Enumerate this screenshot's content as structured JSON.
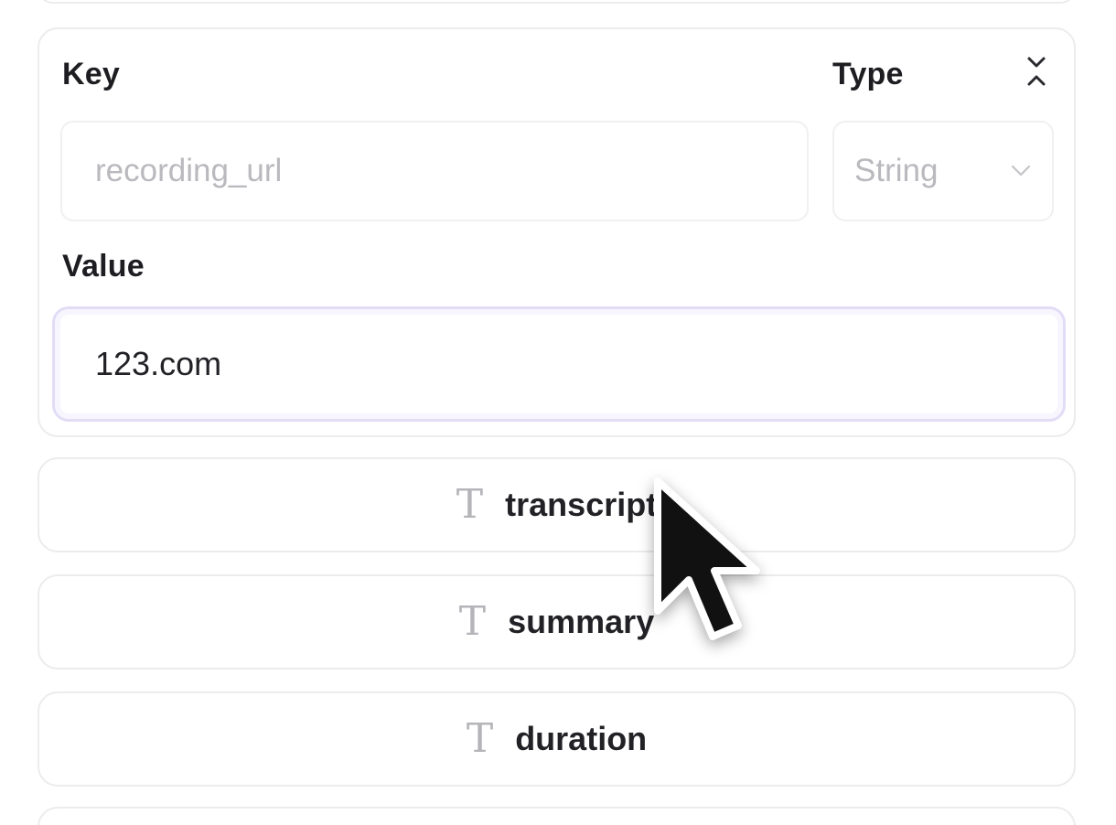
{
  "field_editor": {
    "key_label": "Key",
    "type_label": "Type",
    "value_label": "Value",
    "key_placeholder": "recording_url",
    "type_selected": "String",
    "value": "123.com",
    "collapse_icon": "collapse-chevrons-icon"
  },
  "fields": [
    {
      "icon": "text-type-icon",
      "label": "transcript"
    },
    {
      "icon": "text-type-icon",
      "label": "summary"
    },
    {
      "icon": "text-type-icon",
      "label": "duration"
    }
  ],
  "colors": {
    "border": "#ececef",
    "focus_border": "#e3dcf7",
    "placeholder": "#b9b9be",
    "text": "#1e1e22"
  }
}
